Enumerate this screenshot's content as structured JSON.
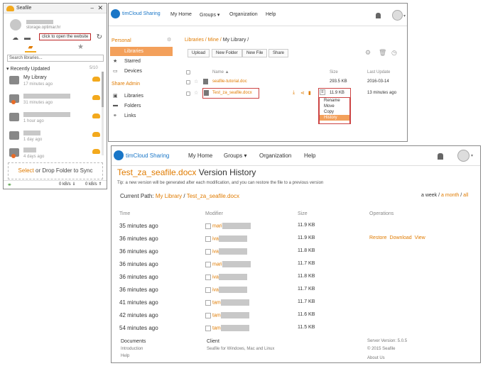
{
  "client": {
    "title": "Seafile",
    "minimize": "–",
    "close": "✕",
    "account_server": "storage.optimar.hr",
    "tooltip": "click to open the website",
    "search_placeholder": "Search libraries...",
    "recent_label": "Recently Updated",
    "recent_count": "5/10",
    "items": [
      {
        "name": "My Library",
        "time": "17 minutes ago"
      },
      {
        "name": "",
        "time": "31 minutes ago"
      },
      {
        "name": "",
        "time": "1 hour ago"
      },
      {
        "name": "",
        "time": "1 day ago"
      },
      {
        "name": "",
        "time": "4 days ago"
      }
    ],
    "drop_select": "Select",
    "drop_rest": " or Drop Folder to Sync",
    "down_rate": "0 kB/s ⇓",
    "up_rate": "0 kB/s ⇑"
  },
  "web1": {
    "brand": "timCloud Sharing",
    "nav": [
      "My Home",
      "Groups ▾",
      "Organization",
      "Help"
    ],
    "personal": "Personal",
    "libraries": "Libraries",
    "starred": "Starred",
    "devices": "Devices",
    "share_admin": "Share Admin",
    "sa_libraries": "Libraries",
    "sa_folders": "Folders",
    "sa_links": "Links",
    "path_a": "Libraries / Mine / ",
    "path_b": "My Library /",
    "buttons": [
      "Upload",
      "New Folder",
      "New File",
      "Share"
    ],
    "col_name": "Name ▲",
    "col_size": "Size",
    "col_update": "Last Update",
    "files": [
      {
        "name": "seafile-tutorial.doc",
        "size": "293.5 KB",
        "updated": "2016-03-14"
      },
      {
        "name": "Test_za_seafile.docx",
        "size": "11.9 KB",
        "updated": "13 minutes ago"
      }
    ],
    "menu": [
      "Rename",
      "Move",
      "Copy",
      "History"
    ]
  },
  "web2": {
    "brand": "timCloud Sharing",
    "nav": [
      "My Home",
      "Groups ▾",
      "Organization",
      "Help"
    ],
    "title_file": "Test_za_seafile.docx",
    "title_rest": " Version History",
    "tip": "Tip: a new version will be generated after each modification, and you can restore the file to a previous version",
    "current_path_label": "Current Path: ",
    "current_path_lib": "My Library",
    "current_path_sep": " / ",
    "current_path_file": "Test_za_seafile.docx",
    "range_week": "a week",
    "range_sep1": " / ",
    "range_month": "a month",
    "range_sep2": " / ",
    "range_all": "all",
    "col_time": "Time",
    "col_modifier": "Modifier",
    "col_size": "Size",
    "col_ops": "Operations",
    "rows": [
      {
        "time": "35 minutes ago",
        "mod": "mari",
        "size": "11.9 KB"
      },
      {
        "time": "36 minutes ago",
        "mod": "iva",
        "size": "11.9 KB"
      },
      {
        "time": "36 minutes ago",
        "mod": "iva",
        "size": "11.8 KB"
      },
      {
        "time": "36 minutes ago",
        "mod": "mari",
        "size": "11.7 KB"
      },
      {
        "time": "36 minutes ago",
        "mod": "iva",
        "size": "11.8 KB"
      },
      {
        "time": "36 minutes ago",
        "mod": "iva",
        "size": "11.7 KB"
      },
      {
        "time": "41 minutes ago",
        "mod": "tam",
        "size": "11.7 KB"
      },
      {
        "time": "42 minutes ago",
        "mod": "tam",
        "size": "11.6 KB"
      },
      {
        "time": "54 minutes ago",
        "mod": "tam",
        "size": "11.5 KB"
      }
    ],
    "ops": [
      "Restore",
      "Download",
      "View"
    ],
    "footer": {
      "docs": "Documents",
      "intro": "Introduction",
      "help": "Help",
      "client": "Client",
      "client_desc": "Seafile for Windows, Mac and Linux",
      "version": "Server Version: 5.0.5",
      "copyright": "© 2015 Seafile",
      "about": "About Us"
    }
  }
}
